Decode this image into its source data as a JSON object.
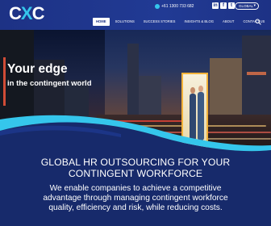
{
  "brand": {
    "logo_c1": "C",
    "logo_x": "X",
    "logo_c2": "C"
  },
  "topbar": {
    "phone": "+61 1300 733 682",
    "social": [
      {
        "label": "in",
        "icon": "linkedin-icon"
      },
      {
        "label": "f",
        "icon": "facebook-icon"
      },
      {
        "label": "t",
        "icon": "twitter-icon"
      }
    ],
    "region_select": {
      "value": "GLOBAL",
      "icon": "chevron-down-icon"
    }
  },
  "nav": {
    "items": [
      {
        "label": "HOME",
        "active": true
      },
      {
        "label": "SOLUTIONS"
      },
      {
        "label": "SUCCESS STORIES"
      },
      {
        "label": "INSIGHTS & BLOG"
      },
      {
        "label": "ABOUT"
      },
      {
        "label": "CONTACT US"
      }
    ],
    "search_icon": "search-icon"
  },
  "hero": {
    "headline": "Your edge",
    "subline": "in the contingent world"
  },
  "intro": {
    "heading_line1": "GLOBAL HR OUTSOURCING FOR YOUR",
    "heading_line2": "CONTINGENT WORKFORCE",
    "body_line1": "We enable companies to achieve a competitive",
    "body_line2": "advantage through managing contingent workforce",
    "body_line3": "quality, efficiency and risk, while reducing costs."
  },
  "colors": {
    "header_bg": "#1d3285",
    "accent": "#35c6ec",
    "page_bg": "#172a6b"
  }
}
